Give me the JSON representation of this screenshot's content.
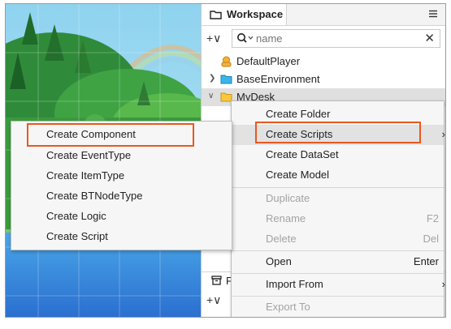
{
  "workspace_panel": {
    "tab_label": "Workspace",
    "tab_icon": "folder-icon",
    "menu_icon": "hamburger-icon",
    "add_label": "+∨",
    "search": {
      "placeholder": "name",
      "value": "",
      "icon": "search-icon",
      "clear_label": "✕"
    },
    "tree": [
      {
        "label": "DefaultPlayer",
        "icon": "player-icon",
        "expandable": false
      },
      {
        "label": "BaseEnvironment",
        "icon": "folder-blue-icon",
        "expandable": true,
        "expanded": false
      },
      {
        "label": "MyDesk",
        "icon": "folder-yellow-icon",
        "expandable": true,
        "expanded": true,
        "selected": true
      }
    ],
    "bottom_panel": {
      "tab_icon": "box-icon",
      "tab_label_partial": "F",
      "add_label": "+∨"
    }
  },
  "context_menu": {
    "items": [
      {
        "label": "Create Folder",
        "shortcut": "",
        "enabled": true
      },
      {
        "label": "Create Scripts",
        "shortcut": "›",
        "enabled": true,
        "highlighted": true
      },
      {
        "label": "Create DataSet",
        "shortcut": "",
        "enabled": true
      },
      {
        "label": "Create Model",
        "shortcut": "",
        "enabled": true
      },
      {
        "label": "Duplicate",
        "shortcut": "",
        "enabled": false
      },
      {
        "label": "Rename",
        "shortcut": "F2",
        "enabled": false
      },
      {
        "label": "Delete",
        "shortcut": "Del",
        "enabled": false
      },
      {
        "label": "Open",
        "shortcut": "Enter",
        "enabled": true
      },
      {
        "label": "Import From",
        "shortcut": "›",
        "enabled": true
      },
      {
        "label": "Export To",
        "shortcut": "",
        "enabled": false
      }
    ]
  },
  "submenu": {
    "items": [
      {
        "label": "Create Component",
        "highlighted": true
      },
      {
        "label": "Create EventType"
      },
      {
        "label": "Create ItemType"
      },
      {
        "label": "Create BTNodeType"
      },
      {
        "label": "Create Logic"
      },
      {
        "label": "Create Script"
      }
    ]
  },
  "colors": {
    "highlight_outline": "#e8581f",
    "menu_bg": "#f6f6f6",
    "disabled_text": "#a3a3a3"
  }
}
